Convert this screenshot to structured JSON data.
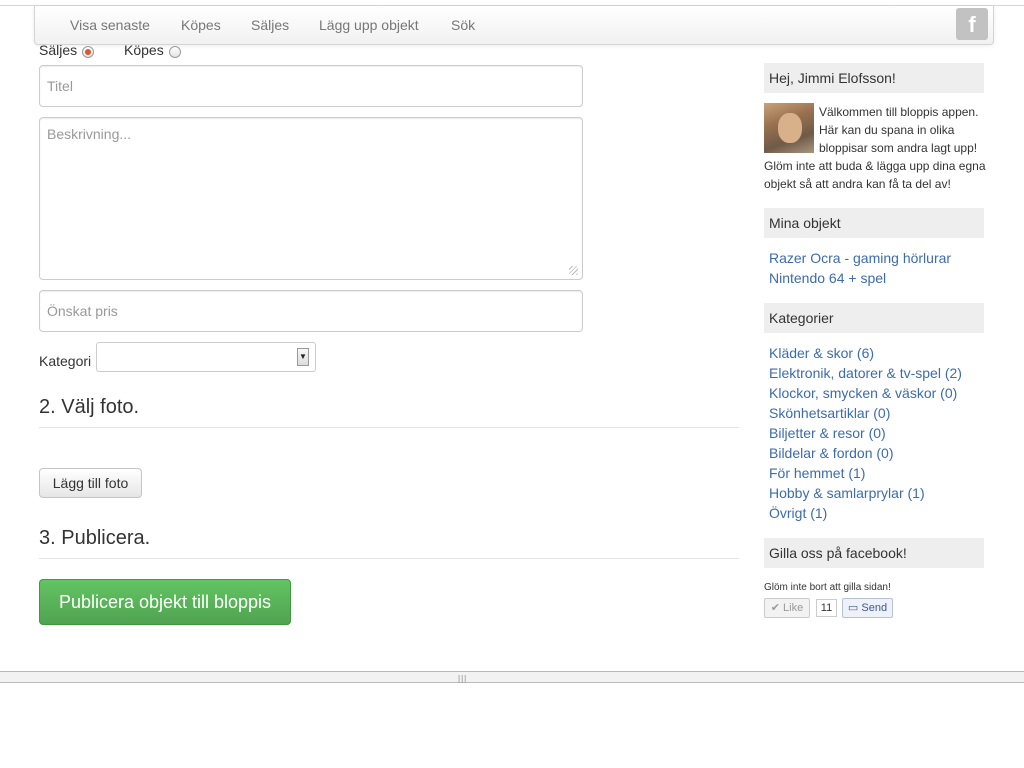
{
  "nav": {
    "items": [
      "Visa senaste",
      "Köpes",
      "Säljes",
      "Lägg upp objekt",
      "Sök"
    ],
    "social_icon": "facebook-icon",
    "social_glyph": "f"
  },
  "form": {
    "type_options": {
      "sell": "Säljes",
      "buy": "Köpes",
      "selected": "Säljes"
    },
    "title_placeholder": "Titel",
    "description_placeholder": "Beskrivning...",
    "price_placeholder": "Önskat pris",
    "category_label": "Kategori",
    "category_value": ""
  },
  "photo": {
    "heading": "2. Välj foto.",
    "add_button": "Lägg till foto"
  },
  "publish": {
    "heading": "3. Publicera.",
    "button": "Publicera objekt till bloppis"
  },
  "sidebar": {
    "greeting": "Hej, Jimmi Elofsson!",
    "welcome_text": "Välkommen till bloppis appen. Här kan du spana in olika bloppisar som andra lagt upp! Glöm inte att buda & lägga upp dina egna objekt så att andra kan få ta del av!",
    "my_items_heading": "Mina objekt",
    "my_items": [
      "Razer Ocra - gaming hörlurar",
      "Nintendo 64 + spel"
    ],
    "categories_heading": "Kategorier",
    "categories": [
      "Kläder & skor (6)",
      "Elektronik, datorer & tv-spel (2)",
      "Klockor, smycken & väskor (0)",
      "Skönhetsartiklar (0)",
      "Biljetter & resor (0)",
      "Bildelar & fordon (0)",
      "För hemmet (1)",
      "Hobby & samlarprylar (1)",
      "Övrigt (1)"
    ],
    "facebook_heading": "Gilla oss på facebook!",
    "facebook_text": "Glöm inte bort att gilla sidan!",
    "like_label": "Like",
    "like_count": "11",
    "send_label": "Send"
  },
  "colors": {
    "link": "#3c6bb0",
    "publish_button": "#5bb75b",
    "radio_selected": "#e0542a"
  }
}
